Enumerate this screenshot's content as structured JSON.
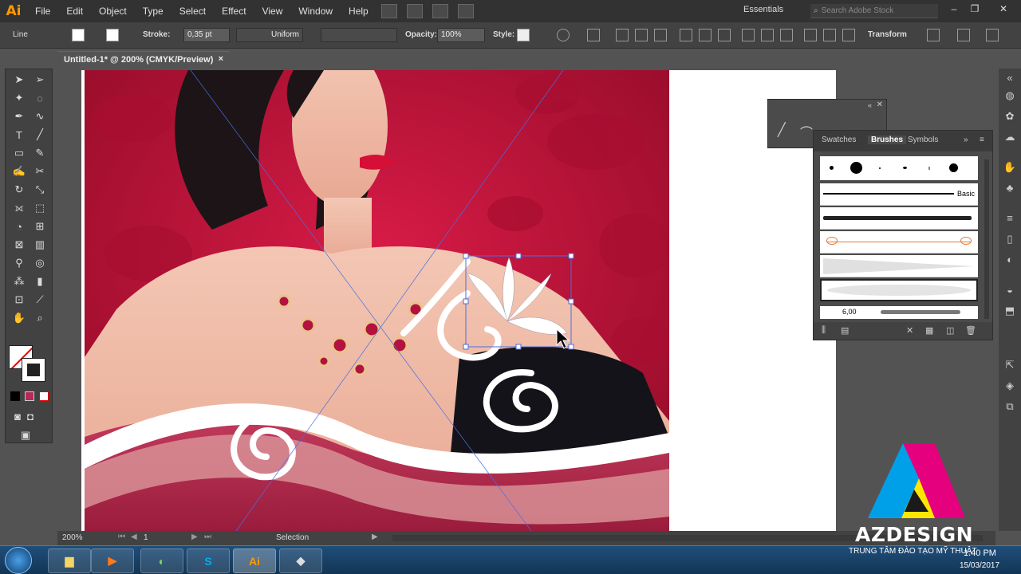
{
  "app": {
    "logo": "Ai"
  },
  "menu": [
    "File",
    "Edit",
    "Object",
    "Type",
    "Select",
    "Effect",
    "View",
    "Window",
    "Help"
  ],
  "workspace": "Essentials",
  "search": {
    "placeholder": "Search Adobe Stock"
  },
  "control": {
    "selection_label": "Line",
    "stroke_label": "Stroke:",
    "stroke_value": "0,35 pt",
    "profile": "Uniform",
    "opacity_label": "Opacity:",
    "opacity_value": "100%",
    "style_label": "Style:",
    "transform_label": "Transform"
  },
  "document_tab": {
    "title": "Untitled-1* @ 200% (CMYK/Preview)",
    "close": "×"
  },
  "brushes_panel": {
    "tabs": [
      "Swatches",
      "Brushes",
      "Symbols"
    ],
    "active_tab": "Brushes",
    "basic_label": "Basic",
    "size_value": "6,00"
  },
  "status": {
    "zoom": "200%",
    "page": "1",
    "tool": "Selection"
  },
  "taskbar": {
    "time": "1:40 PM",
    "date": "15/03/2017"
  },
  "brand": {
    "name": "AZDESIGN",
    "tagline": "TRUNG TÂM ĐÀO TẠO MỸ THUẬT"
  },
  "colors": {
    "accent": "#ff9a00",
    "panel": "#424242",
    "canvas": "#535353",
    "brand_magenta": "#e5007e",
    "brand_cyan": "#00a0e9",
    "brand_yellow": "#ffe600"
  }
}
